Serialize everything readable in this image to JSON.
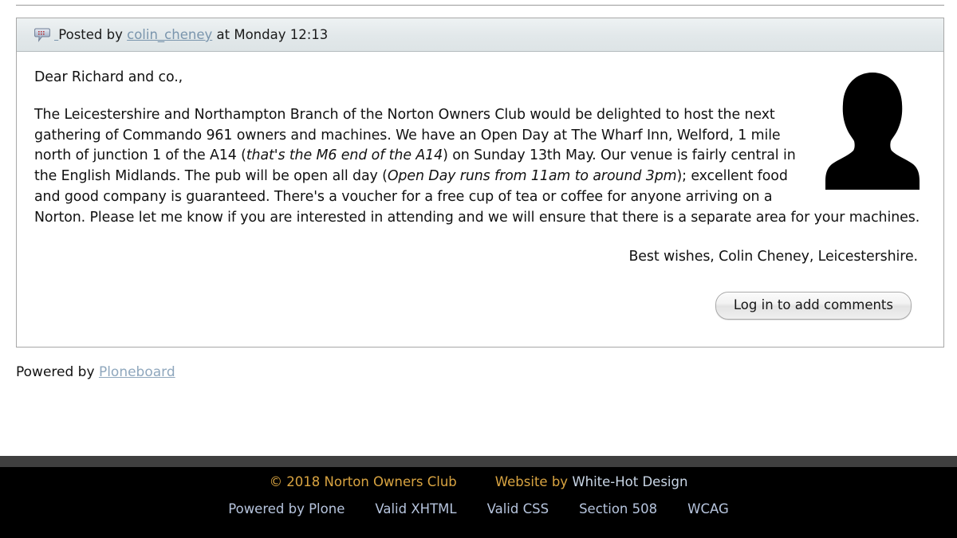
{
  "post": {
    "icon": "comment-bubble-icon",
    "posted_by_prefix": "Posted by",
    "author": "colin_cheney",
    "at_text": "at",
    "timestamp": "Monday 12:13",
    "avatar_alt": "default-user-silhouette",
    "paragraphs": {
      "greeting": "Dear Richard and co.,",
      "body_part_1": "The Leicestershire and Northampton Branch of the Norton Owners Club would be delighted to host the next gathering of Commando 961 owners and machines.  We have an Open Day at The Wharf Inn, Welford, 1 mile north of junction 1 of the A14 (",
      "body_italic_1": "that's the M6 end of the A14",
      "body_part_2": ") on Sunday 13th May.  Our venue is fairly central in the English Midlands.  The pub will be open all day (",
      "body_italic_2": "Open Day runs from 11am to around 3pm",
      "body_part_3": "); excellent food and good company is guaranteed.  There's a voucher for a free cup of tea or coffee for anyone arriving on a Norton.  Please let me know if you are interested in attending and we will ensure that there is a separate area for your machines."
    },
    "signoff": "Best wishes, Colin Cheney, Leicestershire.",
    "login_button_label": "Log in to add comments"
  },
  "powered_by": {
    "prefix": "Powered by",
    "link_label": "Ploneboard"
  },
  "footer": {
    "copyright": "© 2018 Norton Owners Club",
    "website_by_prefix": "Website by",
    "website_by_studio": "White-Hot Design",
    "links": [
      {
        "label": "Powered by Plone"
      },
      {
        "label": "Valid XHTML"
      },
      {
        "label": "Valid CSS"
      },
      {
        "label": "Section 508"
      },
      {
        "label": "WCAG"
      }
    ],
    "colors": {
      "accent_gold": "#d9a441",
      "link_blue": "#b6c4dd",
      "band_gray": "#3f3f3f",
      "background": "#000000"
    }
  }
}
